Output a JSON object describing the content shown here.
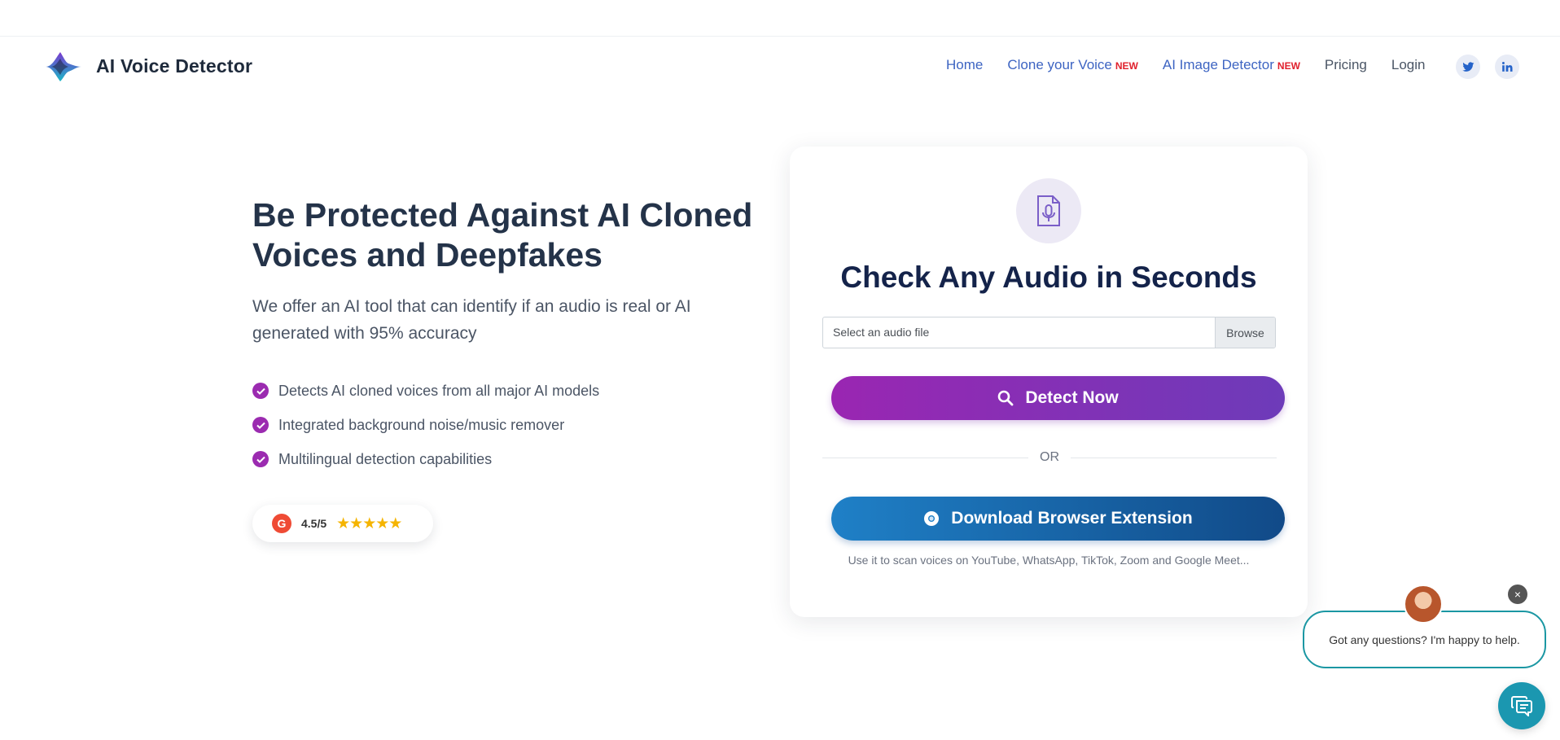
{
  "header": {
    "brand": "AI Voice Detector",
    "nav": [
      {
        "label": "Home",
        "badge": ""
      },
      {
        "label": "Clone your Voice",
        "badge": "NEW"
      },
      {
        "label": "AI Image Detector",
        "badge": "NEW"
      },
      {
        "label": "Pricing",
        "badge": ""
      },
      {
        "label": "Login",
        "badge": ""
      }
    ],
    "social": [
      "twitter-icon",
      "linkedin-icon"
    ]
  },
  "hero": {
    "title": "Be Protected Against AI Cloned Voices and Deepfakes",
    "subtitle": "We offer an AI tool that can identify if an audio is real or AI generated with 95% accuracy",
    "features": [
      "Detects AI cloned voices from all major AI models",
      "Integrated background noise/music remover",
      "Multilingual detection capabilities"
    ],
    "rating": {
      "value": "4.5/5",
      "stars": 5
    }
  },
  "card": {
    "title": "Check Any Audio in Seconds",
    "file_placeholder": "Select an audio file",
    "browse_label": "Browse",
    "detect_label": "Detect Now",
    "or_label": "OR",
    "extension_label": "Download Browser Extension",
    "extension_note": "Use it to scan voices on YouTube, WhatsApp, TikTok, Zoom and Google Meet..."
  },
  "chat": {
    "message": "Got any questions? I'm happy to help.",
    "close_symbol": "×"
  },
  "colors": {
    "accent_purple": "#9a26b2",
    "accent_blue": "#1f80c7",
    "nav_link": "#3d64c2",
    "new_badge": "#e0202c",
    "chat_teal": "#1b97a3"
  }
}
